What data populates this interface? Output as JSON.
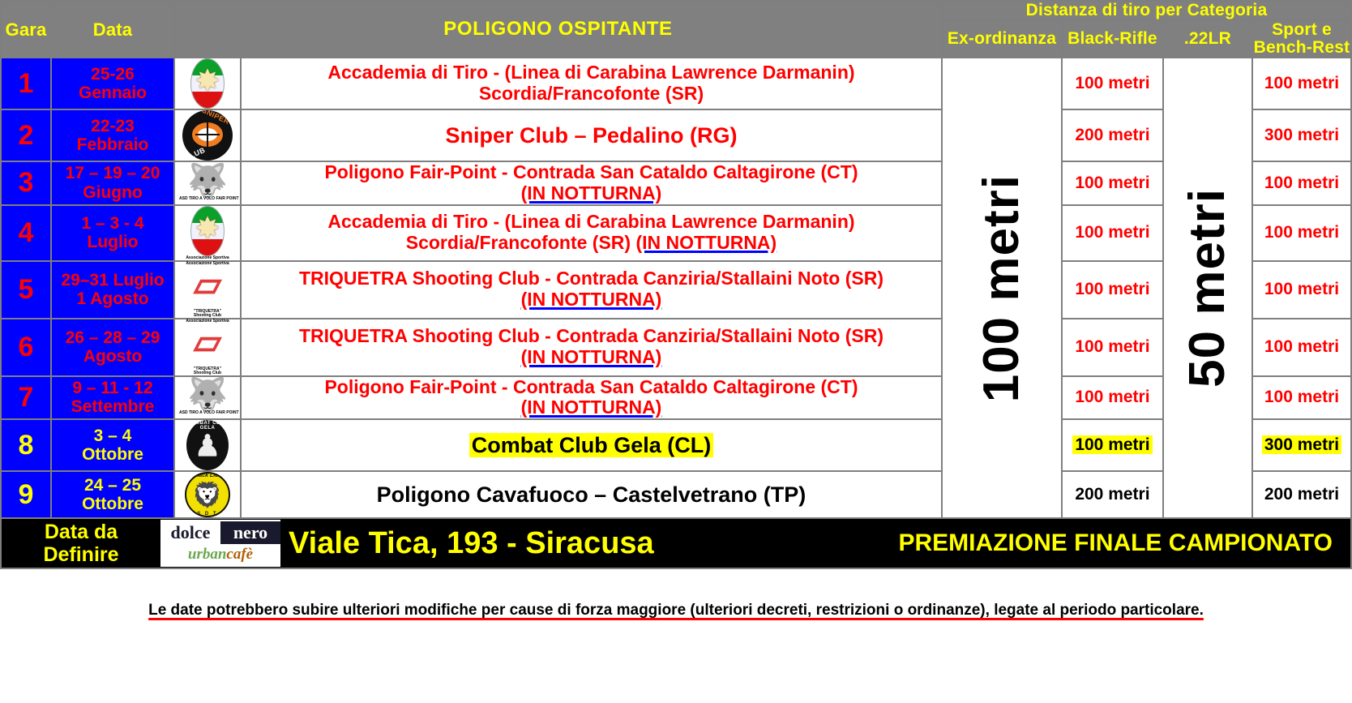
{
  "header": {
    "gara": "Gara",
    "data": "Data",
    "poligono": "POLIGONO OSPITANTE",
    "distance_group": "Distanza di tiro per Categoria",
    "ex_ordinanza": "Ex-ordinanza",
    "black_rifle": "Black-Rifle",
    "lr22": ".22LR",
    "sport_line1": "Sport e",
    "sport_line2": "Bench-Rest"
  },
  "merged": {
    "ex_ordinanza_value": "100 metri",
    "lr22_value": "50 metri"
  },
  "rows": [
    {
      "num": "1",
      "date_line1": "25-26",
      "date_line2": "Gennaio",
      "logo": "accademia-di-tiro-logo",
      "name_line1": "Accademia di Tiro - (Linea di Carabina Lawrence Darmanin)",
      "name_line2": "Scordia/Francofonte (SR)",
      "notturna": "",
      "black_rifle": "100 metri",
      "sport": "100 metri"
    },
    {
      "num": "2",
      "date_line1": "22-23",
      "date_line2": "Febbraio",
      "logo": "sniper-club-logo",
      "name_line1": "Sniper Club – Pedalino (RG)",
      "name_line2": "",
      "notturna": "",
      "black_rifle": "200 metri",
      "sport": "300 metri"
    },
    {
      "num": "3",
      "date_line1": "17 – 19 – 20",
      "date_line2": "Giugno",
      "logo": "fair-point-wolf-logo",
      "name_line1": "Poligono Fair-Point - Contrada San Cataldo Caltagirone (CT)",
      "name_line2": "",
      "notturna": "(IN NOTTURNA)",
      "black_rifle": "100 metri",
      "sport": "100 metri"
    },
    {
      "num": "4",
      "date_line1": "1 – 3 - 4",
      "date_line2": "Luglio",
      "logo": "accademia-di-tiro-logo",
      "name_line1": "Accademia di Tiro - (Linea di Carabina Lawrence Darmanin)",
      "name_line2": "Scordia/Francofonte (SR)",
      "notturna": "(IN NOTTURNA)",
      "notturna_inline": true,
      "black_rifle": "100 metri",
      "sport": "100 metri"
    },
    {
      "num": "5",
      "date_line1": "29–31 Luglio",
      "date_line2": "1 Agosto",
      "logo": "triquetra-logo",
      "name_line1": "TRIQUETRA Shooting Club - Contrada Canziria/Stallaini Noto (SR)",
      "name_line2": "",
      "notturna": "(IN NOTTURNA)",
      "black_rifle": "100 metri",
      "sport": "100 metri"
    },
    {
      "num": "6",
      "date_line1": "26 – 28 – 29",
      "date_line2": "Agosto",
      "logo": "triquetra-logo",
      "name_line1": "TRIQUETRA Shooting Club - Contrada Canziria/Stallaini Noto (SR)",
      "name_line2": "",
      "notturna": "(IN NOTTURNA)",
      "black_rifle": "100 metri",
      "sport": "100 metri"
    },
    {
      "num": "7",
      "date_line1": "9 – 11 - 12",
      "date_line2": "Settembre",
      "logo": "fair-point-wolf-logo",
      "name_line1": "Poligono Fair-Point - Contrada San Cataldo Caltagirone (CT)",
      "name_line2": "",
      "notturna": "(IN NOTTURNA)",
      "black_rifle": "100 metri",
      "sport": "100 metri"
    },
    {
      "num": "8",
      "date_line1": "3 – 4",
      "date_line2": "Ottobre",
      "logo": "combat-club-gela-logo",
      "name_line1": "Combat Club Gela (CL)",
      "name_line2": "",
      "notturna": "",
      "black_rifle": "100 metri",
      "sport": "300 metri"
    },
    {
      "num": "9",
      "date_line1": "24 – 25",
      "date_line2": "Ottobre",
      "logo": "black-lion-logo",
      "name_line1": "Poligono Cavafuoco – Castelvetrano (TP)",
      "name_line2": "",
      "notturna": "",
      "black_rifle": "200 metri",
      "sport": "200 metri"
    }
  ],
  "footer": {
    "date_line1": "Data da",
    "date_line2": "Definire",
    "sponsor_part1": "dolce",
    "sponsor_part2": "nero",
    "sponsor_part3": "urban",
    "sponsor_part4": "cafè",
    "address": "Viale Tica, 193 - Siracusa",
    "premiazione": "PREMIAZIONE FINALE CAMPIONATO"
  },
  "disclaimer": "Le date potrebbero subire ulteriori modifiche per cause di forza maggiore (ulteriori decreti, restrizioni o ordinanze), legate al periodo particolare.",
  "colors": {
    "header_bg": "#808080",
    "header_text": "#ffff00",
    "row_label_bg": "#0000ff",
    "row_label_text": "#ff0000",
    "row_label_text_alt": "#ffff00",
    "venue_text": "#ff0000",
    "highlight": "#ffff00",
    "footer_bg": "#000000",
    "disclaimer_underline": "#ff0000"
  }
}
